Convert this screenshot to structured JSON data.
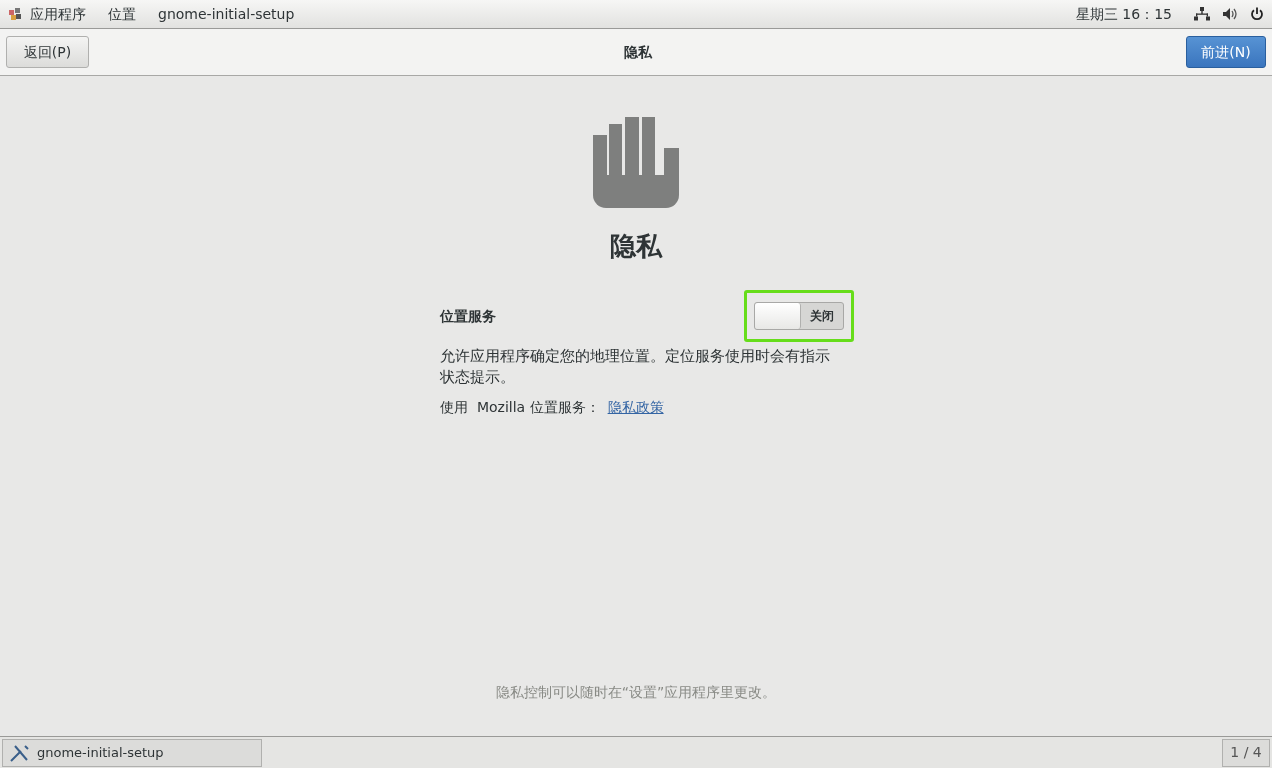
{
  "top_bar": {
    "menus": [
      "应用程序",
      "位置",
      "gnome-initial-setup"
    ],
    "clock": "星期三 16：15"
  },
  "header": {
    "back_button": "返回(P)",
    "title": "隐私",
    "next_button": "前进(N)"
  },
  "page": {
    "heading": "隐私",
    "location_service": {
      "label": "位置服务",
      "switch": {
        "on": false,
        "label": "关闭"
      },
      "description": "允许应用程序确定您的地理位置。定位服务使用时会有指示状态提示。",
      "provider_text": "使用  Mozilla 位置服务：",
      "policy_link": "隐私政策"
    },
    "footer_note": "隐私控制可以随时在“设置”应用程序里更改。"
  },
  "taskbar": {
    "window_button": "gnome-initial-setup",
    "workspace": "1 / 4"
  }
}
